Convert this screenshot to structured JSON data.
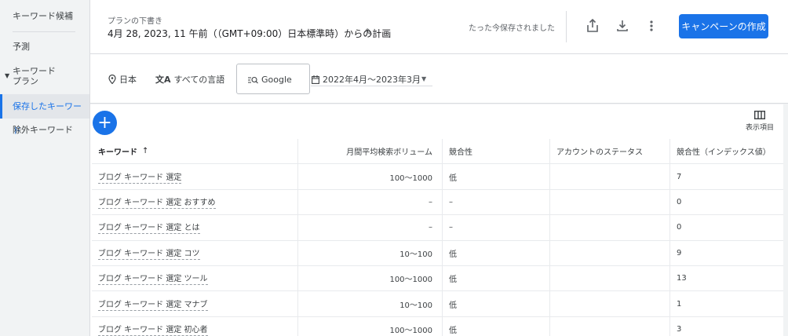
{
  "sidebar": {
    "items": [
      {
        "label": "キーワード候補"
      },
      {
        "label": "予測"
      },
      {
        "label": "キーワード\nプラン"
      },
      {
        "label": "保存したキーワード"
      },
      {
        "label": "除外キーワード"
      }
    ]
  },
  "header": {
    "subtitle": "プランの下書き",
    "title": "4月 28, 2023, 11 午前（（GMT+09:00）日本標準時）からの計画",
    "saved_status": "たった今保存されました",
    "create_button": "キャンペーンの作成"
  },
  "filters": {
    "location": "日本",
    "language": "すべての言語",
    "network": "Google",
    "date_range": "2022年4月～2023年3月"
  },
  "columns_button": "表示項目",
  "table": {
    "headers": [
      "キーワード",
      "月間平均検索ボリューム",
      "競合性",
      "アカウントのステータス",
      "競合性（インデックス値）"
    ],
    "rows": [
      {
        "keyword": "ブログ キーワード 選定",
        "volume": "100～1000",
        "competition": "低",
        "status": "",
        "index": "7"
      },
      {
        "keyword": "ブログ キーワード 選定 おすすめ",
        "volume": "–",
        "competition": "–",
        "status": "",
        "index": "0"
      },
      {
        "keyword": "ブログ キーワード 選定 とは",
        "volume": "–",
        "competition": "–",
        "status": "",
        "index": "0"
      },
      {
        "keyword": "ブログ キーワード 選定 コツ",
        "volume": "10～100",
        "competition": "低",
        "status": "",
        "index": "9"
      },
      {
        "keyword": "ブログ キーワード 選定 ツール",
        "volume": "100～1000",
        "competition": "低",
        "status": "",
        "index": "13"
      },
      {
        "keyword": "ブログ キーワード 選定 マナブ",
        "volume": "10～100",
        "competition": "低",
        "status": "",
        "index": "1"
      },
      {
        "keyword": "ブログ キーワード 選定 初心者",
        "volume": "100～1000",
        "competition": "低",
        "status": "",
        "index": "3"
      }
    ]
  },
  "colors": {
    "accent": "#1a73e8"
  }
}
